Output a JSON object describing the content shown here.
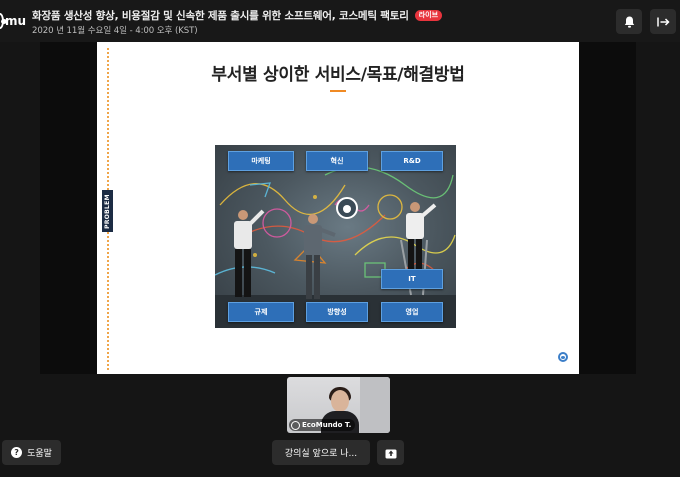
{
  "header": {
    "logo_text": "mu",
    "title": "화장품 생산성 향상, 비용절감 및 신속한 제품 출시를 위한 소프트웨어, 코스메틱 팩토리",
    "live_badge": "라이브",
    "date": "2020 년 11월 수요일 4일 - 4:00 오후 (KST)",
    "buttons": {
      "notification_icon": "bell-icon",
      "exit_icon": "exit-arrow-icon"
    }
  },
  "slide": {
    "title": "부서별 상이한 서비스/목표/해결방법",
    "side_tag": "PROBLEM",
    "labels": {
      "marketing": "마케팅",
      "innovation": "혁신",
      "rnd": "R&D",
      "it": "IT",
      "regulation": "규제",
      "direction": "방향성",
      "sales": "영업"
    },
    "accent_color": "#f08a24",
    "label_color": "#2e6fb8"
  },
  "video": {
    "participant_name": "EcoMundo T."
  },
  "footer": {
    "help_label": "도움말",
    "front_label": "강의실 앞으로 나...",
    "share_icon": "screen-share-icon"
  }
}
